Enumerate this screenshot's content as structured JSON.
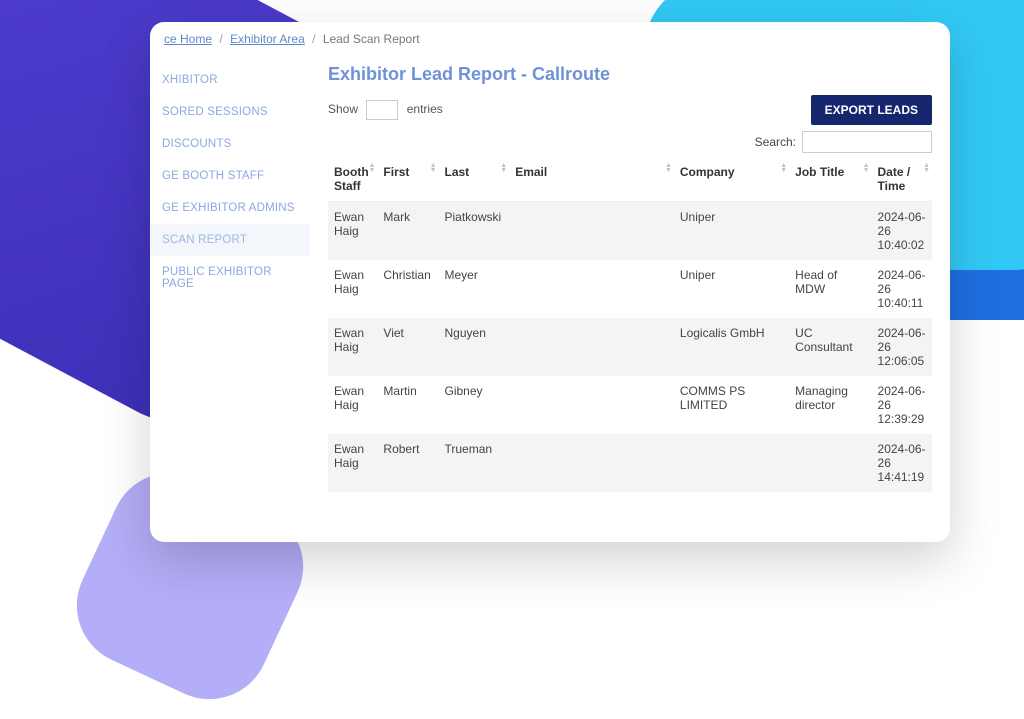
{
  "breadcrumb": {
    "home": "ce Home",
    "exhibitor_area": "Exhibitor Area",
    "current": "Lead Scan Report"
  },
  "sidebar": {
    "items": [
      {
        "label": "XHIBITOR"
      },
      {
        "label": "SORED SESSIONS"
      },
      {
        "label": "DISCOUNTS"
      },
      {
        "label": "GE BOOTH STAFF"
      },
      {
        "label": "GE EXHIBITOR ADMINS"
      },
      {
        "label": "SCAN REPORT"
      },
      {
        "label": "PUBLIC EXHIBITOR PAGE"
      }
    ],
    "active_index": 5
  },
  "page": {
    "title": "Exhibitor Lead Report - Callroute",
    "show_label_prefix": "Show",
    "show_label_suffix": "entries",
    "entries_value": "",
    "export_button": "EXPORT LEADS",
    "search_label": "Search:",
    "search_value": ""
  },
  "table": {
    "headers": {
      "booth": "Booth Staff",
      "first": "First",
      "last": "Last",
      "email": "Email",
      "company": "Company",
      "job": "Job Title",
      "date": "Date / Time"
    },
    "rows": [
      {
        "booth": "Ewan Haig",
        "first": "Mark",
        "last": "Piatkowski",
        "email": "",
        "company": "Uniper",
        "job": "",
        "date": "2024-06-26 10:40:02"
      },
      {
        "booth": "Ewan Haig",
        "first": "Christian",
        "last": "Meyer",
        "email": "",
        "company": "Uniper",
        "job": "Head of MDW",
        "date": "2024-06-26 10:40:11"
      },
      {
        "booth": "Ewan Haig",
        "first": "Viet",
        "last": "Nguyen",
        "email": "",
        "company": "Logicalis GmbH",
        "job": "UC Consultant",
        "date": "2024-06-26 12:06:05"
      },
      {
        "booth": "Ewan Haig",
        "first": "Martin",
        "last": "Gibney",
        "email": "",
        "company": "COMMS PS LIMITED",
        "job": "Managing director",
        "date": "2024-06-26 12:39:29"
      },
      {
        "booth": "Ewan Haig",
        "first": "Robert",
        "last": "Trueman",
        "email": "",
        "company": "",
        "job": "",
        "date": "2024-06-26 14:41:19"
      }
    ]
  }
}
